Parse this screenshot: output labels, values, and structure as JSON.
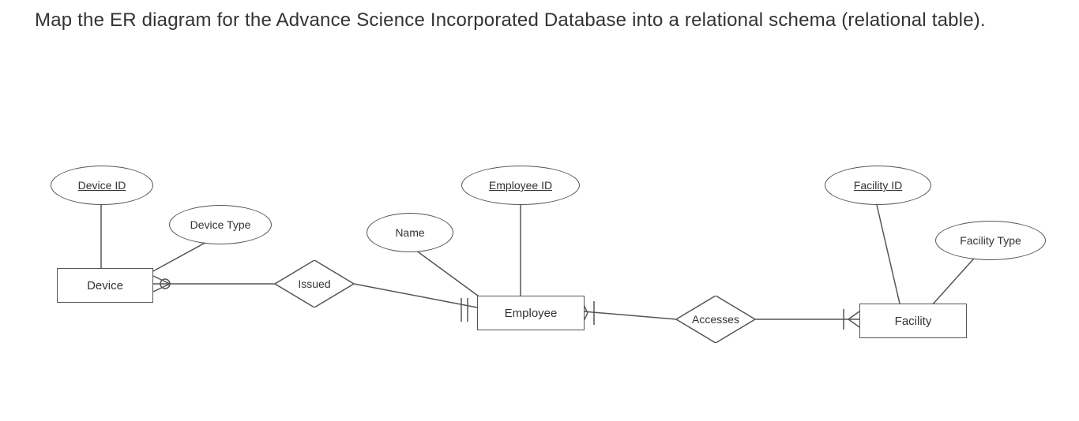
{
  "prompt": "Map the ER diagram for the Advance Science Incorporated Database into a relational schema (relational table).",
  "er": {
    "entities": {
      "device": {
        "label": "Device"
      },
      "employee": {
        "label": "Employee"
      },
      "facility": {
        "label": "Facility"
      }
    },
    "attributes": {
      "device_id": {
        "label": "Device ID",
        "key": true,
        "of": "device"
      },
      "device_type": {
        "label": "Device Type",
        "key": false,
        "of": "device"
      },
      "employee_id": {
        "label": "Employee ID",
        "key": true,
        "of": "employee"
      },
      "name": {
        "label": "Name",
        "key": false,
        "of": "employee"
      },
      "facility_id": {
        "label": "Facility ID",
        "key": true,
        "of": "facility"
      },
      "facility_type": {
        "label": "Facility Type",
        "key": false,
        "of": "facility"
      }
    },
    "relationships": {
      "issued": {
        "label": "Issued",
        "between": [
          "device",
          "employee"
        ],
        "cardinality": {
          "device": "zero-or-many",
          "employee": "one-and-only-one"
        }
      },
      "accesses": {
        "label": "Accesses",
        "between": [
          "employee",
          "facility"
        ],
        "cardinality": {
          "employee": "one-and-only-one",
          "facility": "one-or-many"
        }
      }
    }
  }
}
